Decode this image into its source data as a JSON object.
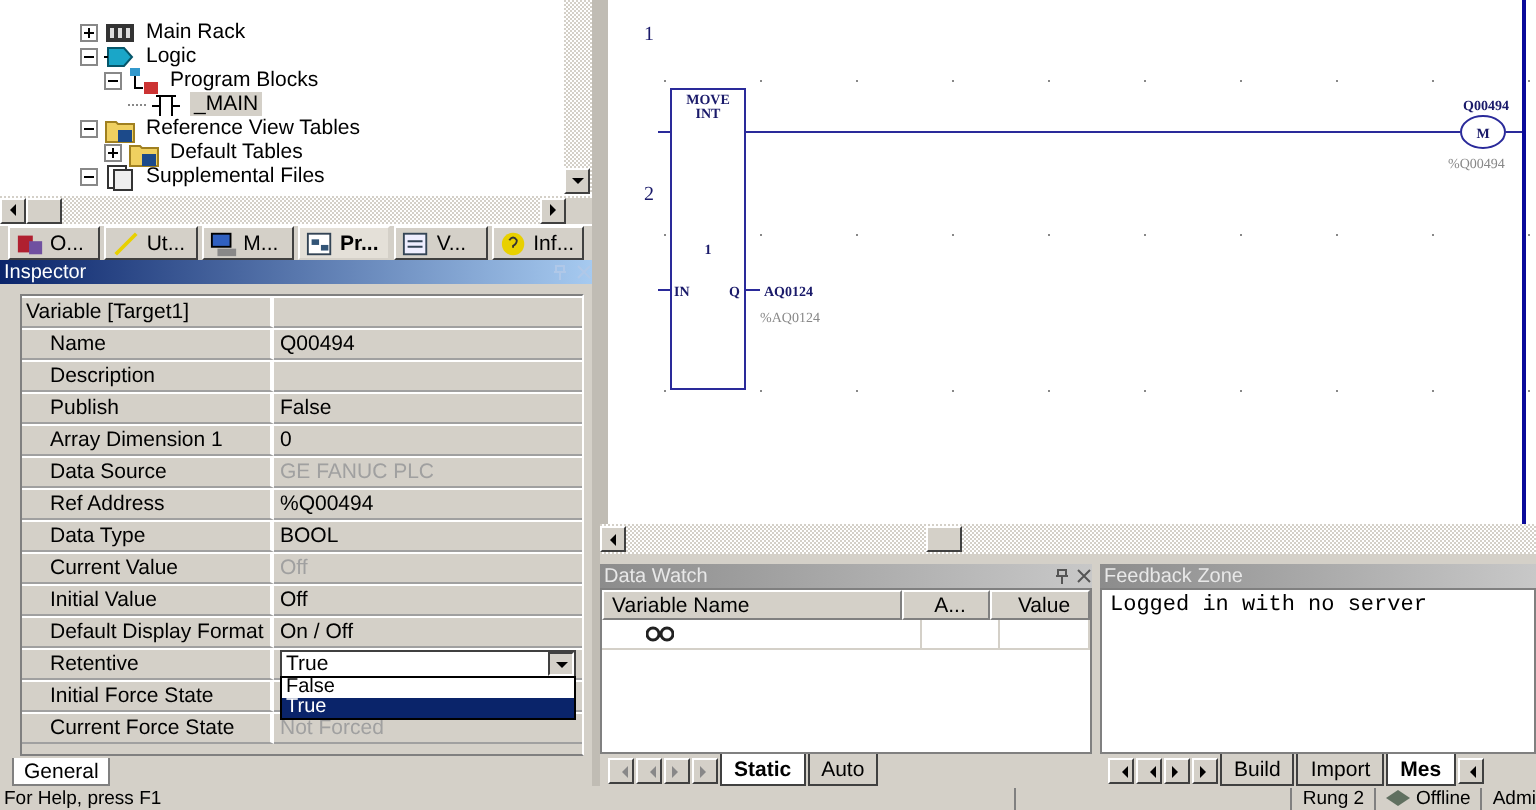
{
  "tree": {
    "items": [
      {
        "label": "Main Rack",
        "kind": "rack",
        "expanded": false,
        "selected": false
      },
      {
        "label": "Logic",
        "kind": "logic",
        "expanded": true,
        "selected": false,
        "children": [
          {
            "label": "Program Blocks",
            "kind": "blocks",
            "expanded": true,
            "selected": false,
            "children": [
              {
                "label": "_MAIN",
                "kind": "block",
                "selected": true
              }
            ]
          }
        ]
      },
      {
        "label": "Reference View Tables",
        "kind": "folder",
        "expanded": true,
        "selected": false,
        "children": [
          {
            "label": "Default Tables",
            "kind": "folder",
            "expanded": false,
            "selected": false
          }
        ]
      },
      {
        "label": "Supplemental Files",
        "kind": "files",
        "expanded": true,
        "selected": false
      }
    ]
  },
  "navigator_tabs": [
    {
      "label": "O...",
      "kind": "options",
      "selected": false
    },
    {
      "label": "Ut...",
      "kind": "utilities",
      "selected": false
    },
    {
      "label": "M...",
      "kind": "manager",
      "selected": false
    },
    {
      "label": "Pr...",
      "kind": "project",
      "selected": true
    },
    {
      "label": "V...",
      "kind": "variables",
      "selected": false
    },
    {
      "label": "Inf...",
      "kind": "info",
      "selected": false
    }
  ],
  "inspector": {
    "title": "Inspector",
    "header": "Variable [Target1]",
    "rows": [
      {
        "label": "Name",
        "value": "Q00494",
        "kind": "text"
      },
      {
        "label": "Description",
        "kind": "text"
      },
      {
        "label": "Publish",
        "value": "False",
        "kind": "text"
      },
      {
        "label": "Array Dimension 1",
        "value": "0",
        "kind": "text"
      },
      {
        "label": "Data Source",
        "value": "GE FANUC PLC",
        "kind": "readonly"
      },
      {
        "label": "Ref Address",
        "value": "%Q00494",
        "kind": "text"
      },
      {
        "label": "Data Type",
        "value": "BOOL",
        "kind": "text"
      },
      {
        "label": "Current Value",
        "value": "Off",
        "kind": "readonly"
      },
      {
        "label": "Initial Value",
        "value": "Off",
        "kind": "text"
      },
      {
        "label": "Default Display Format",
        "value": "On / Off",
        "kind": "text"
      },
      {
        "label": "Retentive",
        "value": "True",
        "kind": "dropdown",
        "expanded": true,
        "options": [
          {
            "label": "False",
            "selected": false
          },
          {
            "label": "True",
            "selected": true
          }
        ]
      },
      {
        "label": "Initial Force State",
        "kind": "text"
      },
      {
        "label": "Current Force State",
        "value": "Not Forced",
        "kind": "readonly"
      }
    ],
    "tab": "General"
  },
  "ladder": {
    "rungs": [
      "1",
      "2"
    ],
    "block": {
      "name": "MOVE",
      "type": "INT",
      "length": "1",
      "input": "IN",
      "output_pin": "Q",
      "output_name": "AQ0124",
      "output_address": "%AQ0124"
    },
    "coil": {
      "symbol": "M",
      "name": "Q00494",
      "address": "%Q00494"
    }
  },
  "data_watch": {
    "title": "Data Watch",
    "columns": [
      "Variable Name",
      "A...",
      "Value"
    ],
    "tabs": [
      {
        "label": "Static",
        "selected": true
      },
      {
        "label": "Auto",
        "selected": false
      }
    ]
  },
  "feedback": {
    "title": "Feedback Zone",
    "message": "Logged in with no server",
    "tabs": [
      {
        "label": "Build",
        "selected": false
      },
      {
        "label": "Import",
        "selected": false
      },
      {
        "label": "Mes",
        "selected": true
      }
    ]
  },
  "status_bar": {
    "help": "For Help, press F1",
    "rung": "Rung 2",
    "mode": "Offline",
    "user": "Admi"
  }
}
